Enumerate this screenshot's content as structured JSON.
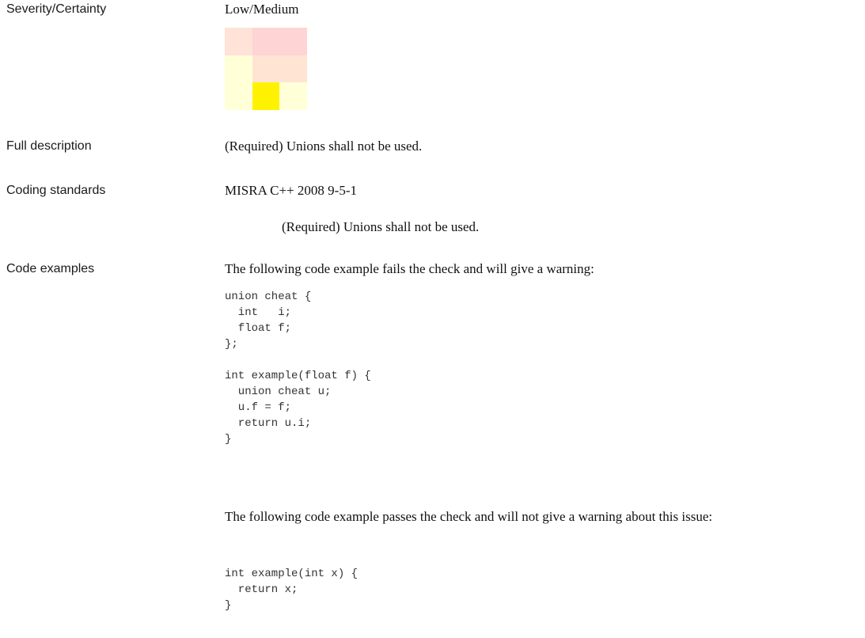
{
  "severity": {
    "label": "Severity/Certainty",
    "value": "Low/Medium",
    "matrix_colors": [
      [
        "#ffe2d8",
        "#ffd4d4",
        "#ffd4d4"
      ],
      [
        "#ffffd8",
        "#ffe4d4",
        "#ffe4d4"
      ],
      [
        "#ffffd8",
        "#fff200",
        "#ffffd8"
      ]
    ]
  },
  "full_description": {
    "label": "Full description",
    "text": "(Required) Unions shall not be used."
  },
  "coding_standards": {
    "label": "Coding standards",
    "standard": "MISRA C++ 2008 9-5-1",
    "rule_text": "(Required) Unions shall not be used."
  },
  "code_examples": {
    "label": "Code examples",
    "fail_intro": "The following code example fails the check and will give a warning:",
    "fail_code": "union cheat {\n  int   i;\n  float f;\n};\n\nint example(float f) {\n  union cheat u;\n  u.f = f;\n  return u.i;\n}",
    "pass_intro": "The following code example passes the check and will not give a warning about this issue:",
    "pass_code": "int example(int x) {\n  return x;\n}"
  }
}
